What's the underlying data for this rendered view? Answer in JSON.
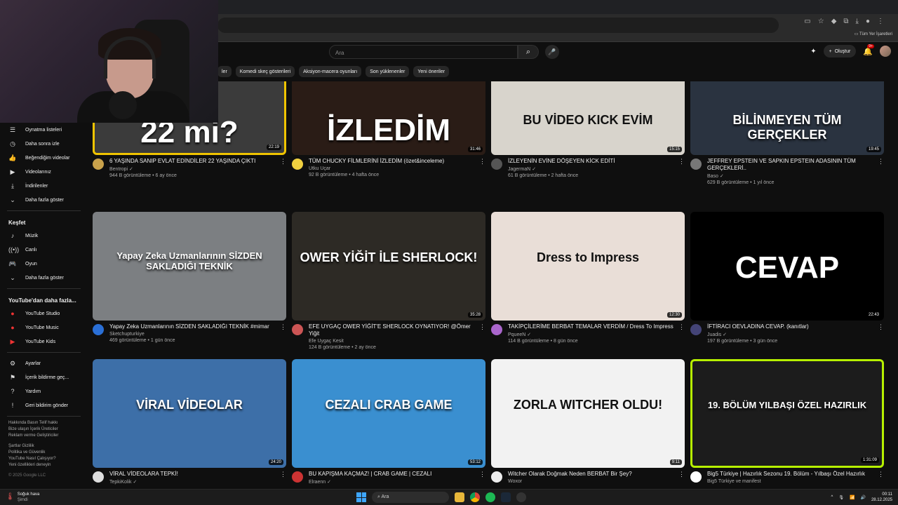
{
  "browser": {
    "bookmarks_label": "Tüm Yer İşaretleri"
  },
  "header": {
    "search_placeholder": "Ara",
    "create_label": "Oluştur",
    "notification_count": "9+"
  },
  "chips": [
    "ler",
    "Komedi skeç gösterileri",
    "Aksiyon-macera oyunları",
    "Son yüklenenler",
    "Yeni öneriler"
  ],
  "sidebar": {
    "you_items": [
      {
        "icon": "playlist-icon",
        "glyph": "☰",
        "label": "Oynatma listeleri"
      },
      {
        "icon": "clock-icon",
        "glyph": "◷",
        "label": "Daha sonra izle"
      },
      {
        "icon": "thumb-up-icon",
        "glyph": "👍",
        "label": "Beğendiğim videolar"
      },
      {
        "icon": "video-icon",
        "glyph": "▶",
        "label": "Videolarınız"
      },
      {
        "icon": "download-icon",
        "glyph": "⤓",
        "label": "İndirilenler"
      },
      {
        "icon": "chevron-down-icon",
        "glyph": "⌄",
        "label": "Daha fazla göster"
      }
    ],
    "explore_heading": "Keşfet",
    "explore_items": [
      {
        "icon": "music-icon",
        "glyph": "♪",
        "label": "Müzik"
      },
      {
        "icon": "live-icon",
        "glyph": "((•))",
        "label": "Canlı"
      },
      {
        "icon": "gamepad-icon",
        "glyph": "🎮",
        "label": "Oyun"
      },
      {
        "icon": "chevron-down-icon",
        "glyph": "⌄",
        "label": "Daha fazla göster"
      }
    ],
    "more_heading": "YouTube'dan daha fazla...",
    "more_items": [
      {
        "icon": "youtube-studio-icon",
        "glyph": "●",
        "label": "YouTube Studio"
      },
      {
        "icon": "youtube-music-icon",
        "glyph": "●",
        "label": "YouTube Music"
      },
      {
        "icon": "youtube-kids-icon",
        "glyph": "▶",
        "label": "YouTube Kids"
      }
    ],
    "settings_items": [
      {
        "icon": "gear-icon",
        "glyph": "⚙",
        "label": "Ayarlar"
      },
      {
        "icon": "flag-icon",
        "glyph": "⚑",
        "label": "İçerik bildirme geç..."
      },
      {
        "icon": "help-icon",
        "glyph": "?",
        "label": "Yardım"
      },
      {
        "icon": "feedback-icon",
        "glyph": "!",
        "label": "Geri bildirim gönder"
      }
    ],
    "footer_lines_1": [
      "Hakkında  Basın  Telif hakkı",
      "Bize ulaşın  İçerik Üreticiler",
      "Reklam verme  Geliştiriciler"
    ],
    "footer_lines_2": [
      "Şartlar  Gizlilik",
      "Politika ve Güvenlik",
      "YouTube Nasıl Çalışıyor?",
      "Yeni özellikleri deneyin"
    ],
    "copyright": "© 2025 Google LLC"
  },
  "videos": [
    {
      "title": "6 YAŞINDA SANIP EVLAT EDİNDİLER 22 YAŞINDA ÇIKTI",
      "channel": "Bentropi ✓",
      "stats": "944 B görüntüleme • 6 ay önce",
      "duration": "22:19",
      "thumb_text": "22 mi?",
      "bg": "#3b3b3b",
      "border": "#f0c400",
      "av": "#c9a24b"
    },
    {
      "title": "TÜM CHUCKY FİLMLERİNİ İZLEDİM (özet&inceleme)",
      "channel": "Utku Uçar",
      "stats": "92 B görüntüleme • 4 hafta önce",
      "duration": "31:46",
      "thumb_text": "İZLEDİM",
      "bg": "#2a1c16",
      "border": "",
      "av": "#f0d040"
    },
    {
      "title": "İZLEYENİN EVİNE DÖŞEYEN KİCK EDİTİ",
      "channel": "JagermaN ✓",
      "stats": "61 B görüntüleme • 2 hafta önce",
      "duration": "15:15",
      "thumb_text": "BU VİDEO  KICK  EVİM",
      "bg": "#d8d4cc",
      "border": "",
      "av": "#555"
    },
    {
      "title": "JEFFREY EPSTEIN VE SAPKIN EPSTEIN ADASININ TÜM GERÇEKLERİ..",
      "channel": "Baso ✓",
      "stats": "629 B görüntüleme • 1 yıl önce",
      "duration": "19:45",
      "thumb_text": "BİLİNMEYEN TÜM GERÇEKLER",
      "bg": "#2a3340",
      "border": "",
      "av": "#777"
    },
    {
      "title": "Yapay Zeka Uzmanlarının SİZDEN SAKLADIĞI TEKNİK #mimar",
      "channel": "Sketchupturkiye",
      "stats": "469 görüntüleme • 1 gün önce",
      "duration": "",
      "thumb_text": "Yapay Zeka Uzmanlarının SİZDEN SAKLADIĞI TEKNİK",
      "bg": "#7c7f82",
      "border": "",
      "av": "#2a6fd6"
    },
    {
      "title": "EFE UYGAÇ OWER YİĞİT'E SHERLOCK OYNATIYOR! @Ömer Yiğit",
      "channel": "Efe Uygaç Kesit",
      "stats": "124 B görüntüleme • 2 ay önce",
      "duration": "35:28",
      "thumb_text": "OWER YİĞİT İLE SHERLOCK!",
      "bg": "#2d2a25",
      "border": "",
      "av": "#c55"
    },
    {
      "title": "TAKİPÇİLERİME BERBAT TEMALAR VERDİM / Dress To Impress",
      "channel": "PqueeN ✓",
      "stats": "114 B görüntüleme • 8 gün önce",
      "duration": "12:30",
      "thumb_text": "Dress to Impress",
      "bg": "#e9ded7",
      "border": "",
      "av": "#a6c"
    },
    {
      "title": "İFTİRACI OEVLADINA CEVAP. (kanıtlar)",
      "channel": "Juadis ✓",
      "stats": "197 B görüntüleme • 3 gün önce",
      "duration": "22:43",
      "thumb_text": "CEVAP",
      "bg": "#000000",
      "border": "",
      "av": "#447"
    },
    {
      "title": "VİRAL VİDEOLARA TEPKİ!",
      "channel": "TepkiKolik ✓",
      "stats": "",
      "duration": "24:20",
      "thumb_text": "VİRAL VİDEOLAR",
      "bg": "#3d6fa8",
      "border": "",
      "av": "#ddd"
    },
    {
      "title": "BU KAPIŞMA KAÇMAZ! | CRAB GAME | CEZALI",
      "channel": "Elraenn ✓",
      "stats": "",
      "duration": "53:12",
      "thumb_text": "CEZALI CRAB GAME",
      "bg": "#3a8fd0",
      "border": "",
      "av": "#c33"
    },
    {
      "title": "Witcher Olarak Doğmak Neden BERBAT Bir Şey?",
      "channel": "Woxor",
      "stats": "",
      "duration": "9:11",
      "thumb_text": "ZORLA WITCHER OLDU!",
      "bg": "#f2f2f2",
      "border": "",
      "av": "#eee"
    },
    {
      "title": "Big5 Türkiye | Hazırlık Sezonu 19. Bölüm - Yılbaşı Özel Hazırlık",
      "channel": "Big5 Türkiye ve manifest",
      "stats": "",
      "duration": "1:31:09",
      "thumb_text": "19. BÖLÜM YILBAŞI ÖZEL HAZIRLIK",
      "bg": "#1c1c1c",
      "border": "#b6f000",
      "av": "#fff"
    }
  ],
  "taskbar": {
    "weather_title": "Soğuk hava",
    "weather_sub": "Şimdi",
    "search_placeholder": "Ara",
    "time": "00:11",
    "date": "28.12.2025"
  }
}
